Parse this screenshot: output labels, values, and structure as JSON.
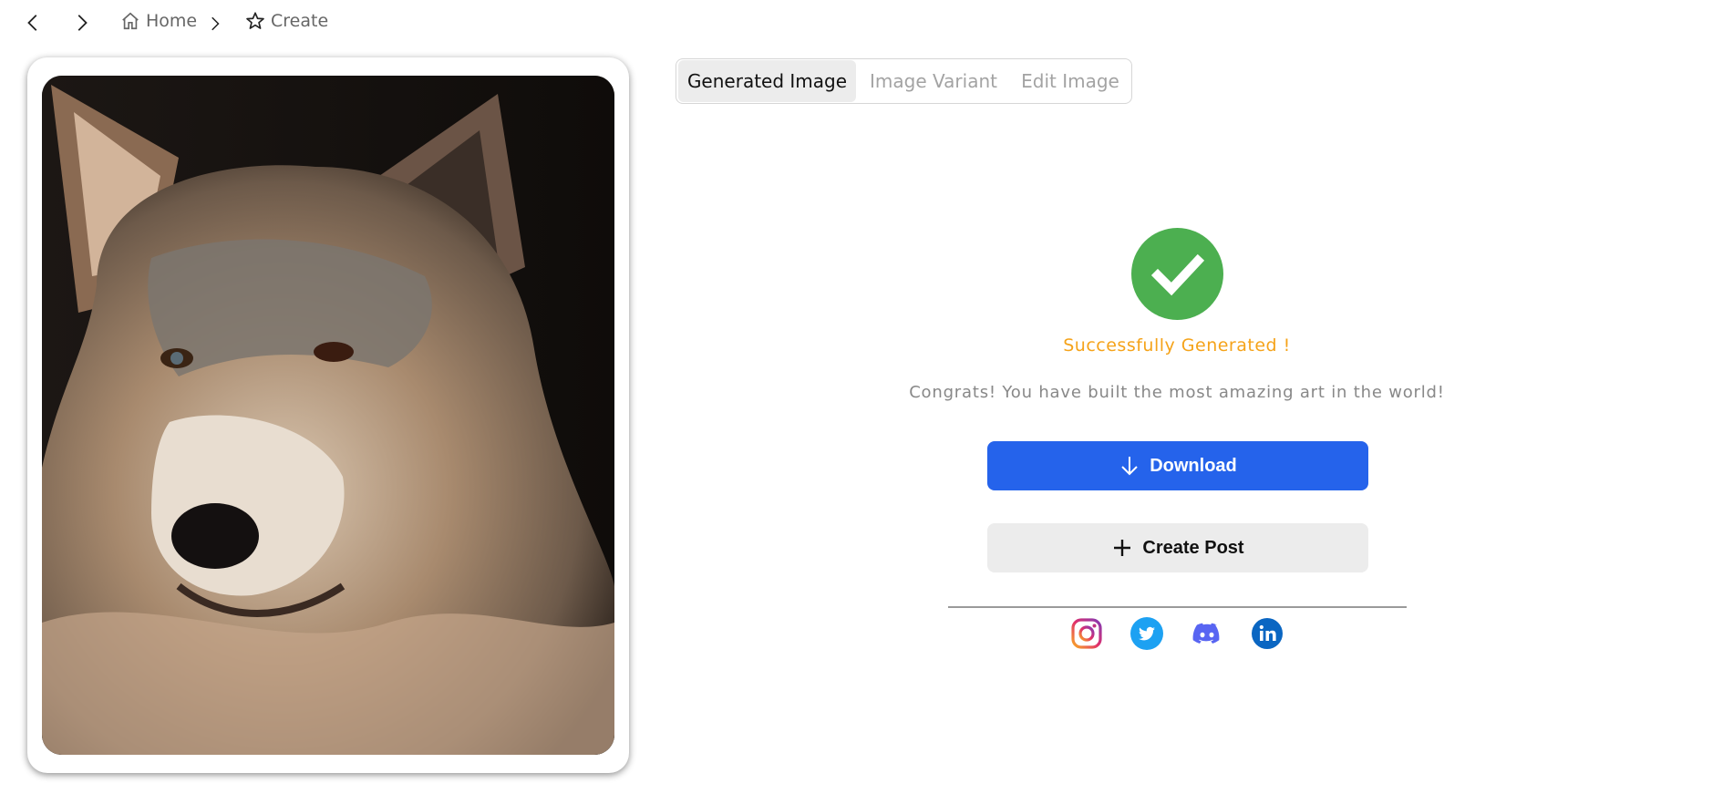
{
  "nav": {
    "back_icon": "chevron-left-icon",
    "forward_icon": "chevron-right-icon"
  },
  "breadcrumb": {
    "items": [
      {
        "label": "Home",
        "icon": "home-icon"
      },
      {
        "label": "Create",
        "icon": "star-icon"
      }
    ]
  },
  "generated_image": {
    "subject": "wolf-portrait"
  },
  "tabs": [
    {
      "label": "Generated Image",
      "active": true
    },
    {
      "label": "Image Variant",
      "active": false
    },
    {
      "label": "Edit Image",
      "active": false
    }
  ],
  "result": {
    "status_icon": "check-circle-icon",
    "title": "Successfully Generated !",
    "message": "Congrats! You have built the most amazing art in the world!"
  },
  "actions": {
    "download_label": "Download",
    "create_post_label": "Create Post"
  },
  "social": {
    "items": [
      {
        "name": "instagram",
        "icon": "instagram-icon"
      },
      {
        "name": "twitter",
        "icon": "twitter-icon"
      },
      {
        "name": "discord",
        "icon": "discord-icon"
      },
      {
        "name": "linkedin",
        "icon": "linkedin-icon"
      }
    ]
  },
  "colors": {
    "accent": "#2563eb",
    "success": "#4caf50",
    "title_orange": "#f5a31a",
    "twitter": "#1da1f2",
    "discord": "#5865f2",
    "linkedin": "#0a66c2"
  }
}
